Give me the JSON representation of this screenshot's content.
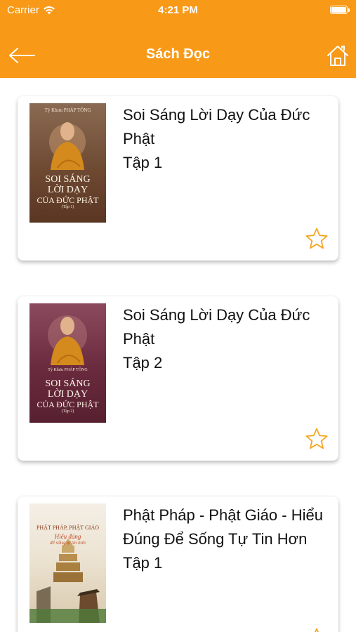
{
  "status": {
    "carrier": "Carrier",
    "time": "4:21 PM"
  },
  "nav": {
    "title": "Sách Đọc",
    "back_icon": "arrow-left-icon",
    "home_icon": "home-icon"
  },
  "colors": {
    "accent": "#F89A17",
    "star": "#F5A623"
  },
  "books": [
    {
      "title": "Soi Sáng Lời Dạy Của Đức Phật",
      "volume": "Tập 1",
      "cover": {
        "author": "Tỳ Khưu PHÁP TÔNG",
        "line1": "SOI SÁNG",
        "line2": "LỜI DẠY",
        "line3": "CỦA ĐỨC PHẬT",
        "sub": "(Tập 1)"
      }
    },
    {
      "title": "Soi Sáng Lời Dạy Của Đức Phật",
      "volume": "Tập 2",
      "cover": {
        "author": "Tỳ Khưu PHÁP TÔNG",
        "line1": "SOI SÁNG",
        "line2": "LỜI DẠY",
        "line3": "CỦA ĐỨC PHẬT",
        "sub": "(Tập 2)"
      }
    },
    {
      "title": "Phật Pháp - Phật Giáo - Hiểu Đúng Để Sống Tự Tin Hơn",
      "volume": "Tập 1",
      "cover": {
        "header": "PHẬT PHÁP, PHẬT GIÁO",
        "sub1": "Hiểu đúng",
        "sub2": "để sống tự tin hơn"
      }
    }
  ]
}
